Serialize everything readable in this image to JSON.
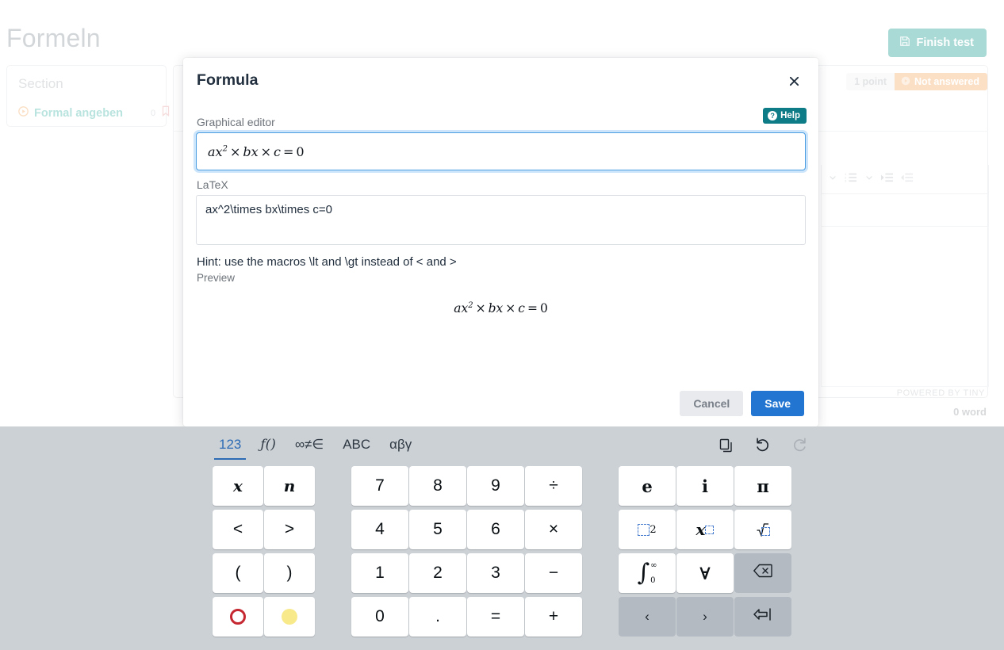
{
  "background": {
    "page_title": "Formeln",
    "finish_button": {
      "label": "Finish test",
      "icon": "save-icon",
      "color": "#a9dad5"
    },
    "section_card": {
      "label": "Section",
      "task": {
        "name": "Formal angeben",
        "count": "0",
        "status_icon": "play-circle-icon",
        "bookmark_icon": "bookmark-icon"
      }
    },
    "status": {
      "points": "1 point",
      "answer_state": "Not answered",
      "state_color": "#fbe0c6"
    },
    "editor": {
      "powered_by": "POWERED BY TINY",
      "word_count": "0 word"
    }
  },
  "modal": {
    "title": "Formula",
    "close_icon": "close-icon",
    "help": {
      "label": "Help",
      "icon": "question-circle-icon",
      "color": "#0e7c86"
    },
    "graphical_editor": {
      "label": "Graphical editor",
      "value": "ax² × bx × c = 0",
      "tokens": [
        "a",
        "x",
        "2",
        "×",
        "b",
        "x",
        "×",
        "c",
        "=",
        "0"
      ],
      "focused": true
    },
    "latex": {
      "label": "LaTeX",
      "value": "ax^2\\times bx\\times c=0"
    },
    "hint": "Hint: use the macros \\lt and \\gt instead of < and >",
    "preview": {
      "label": "Preview",
      "value": "ax² × bx × c = 0"
    },
    "actions": {
      "cancel": "Cancel",
      "save": "Save"
    }
  },
  "keyboard": {
    "tabs": [
      {
        "id": "numbers",
        "label": "123",
        "active": true
      },
      {
        "id": "functions",
        "label": "ƒ()",
        "active": false
      },
      {
        "id": "relations",
        "label": "∞≠∈",
        "active": false
      },
      {
        "id": "abc",
        "label": "ABC",
        "active": false
      },
      {
        "id": "greek",
        "label": "αβγ",
        "active": false
      }
    ],
    "tools": [
      {
        "id": "copy",
        "icon": "copy-icon",
        "disabled": false
      },
      {
        "id": "undo",
        "icon": "undo-icon",
        "disabled": false
      },
      {
        "id": "redo",
        "icon": "redo-icon",
        "disabled": true
      }
    ],
    "group_vars": [
      {
        "label": "x",
        "style": "serif"
      },
      {
        "label": "n",
        "style": "serif"
      },
      {
        "label": "<",
        "style": "plain"
      },
      {
        "label": ">",
        "style": "plain"
      },
      {
        "label": "(",
        "style": "plain"
      },
      {
        "label": ")",
        "style": "plain"
      },
      {
        "label": "",
        "style": "circle-red"
      },
      {
        "label": "",
        "style": "circle-yellow"
      }
    ],
    "group_numpad": [
      {
        "label": "7"
      },
      {
        "label": "8"
      },
      {
        "label": "9"
      },
      {
        "label": "÷"
      },
      {
        "label": "4"
      },
      {
        "label": "5"
      },
      {
        "label": "6"
      },
      {
        "label": "×"
      },
      {
        "label": "1"
      },
      {
        "label": "2"
      },
      {
        "label": "3"
      },
      {
        "label": "−"
      },
      {
        "label": "0"
      },
      {
        "label": "."
      },
      {
        "label": "="
      },
      {
        "label": "+"
      }
    ],
    "group_symbols": [
      {
        "label": "e",
        "style": "upright"
      },
      {
        "label": "i",
        "style": "upright"
      },
      {
        "label": "π",
        "style": "upright"
      },
      {
        "label": "□²",
        "style": "template-square"
      },
      {
        "label": "x^□",
        "style": "template-power"
      },
      {
        "label": "√□",
        "style": "template-sqrt"
      },
      {
        "label": "∫₀^∞",
        "style": "template-integral"
      },
      {
        "label": "∀",
        "style": "upright"
      },
      {
        "label": "backspace",
        "style": "action-backspace"
      },
      {
        "label": "‹",
        "style": "action"
      },
      {
        "label": "›",
        "style": "action"
      },
      {
        "label": "enter",
        "style": "action-enter"
      }
    ]
  }
}
